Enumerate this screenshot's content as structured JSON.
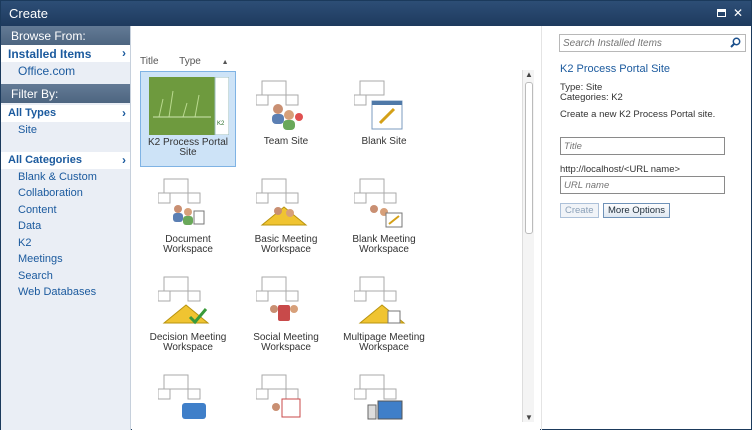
{
  "window": {
    "title": "Create"
  },
  "left": {
    "browse_header": "Browse From:",
    "installed_items": "Installed Items",
    "office": "Office.com",
    "filter_header": "Filter By:",
    "all_types": "All Types",
    "type_items": [
      "Site"
    ],
    "all_categories": "All Categories",
    "categories": [
      "Blank & Custom",
      "Collaboration",
      "Content",
      "Data",
      "K2",
      "Meetings",
      "Search",
      "Web Databases"
    ]
  },
  "middle": {
    "col_title": "Title",
    "col_type": "Type",
    "tiles": [
      {
        "label": "K2 Process Portal Site"
      },
      {
        "label": "Team Site"
      },
      {
        "label": "Blank Site"
      },
      {
        "label": "Document Workspace"
      },
      {
        "label": "Basic Meeting Workspace"
      },
      {
        "label": "Blank Meeting Workspace"
      },
      {
        "label": "Decision Meeting Workspace"
      },
      {
        "label": "Social Meeting Workspace"
      },
      {
        "label": "Multipage Meeting Workspace"
      },
      {
        "label": ""
      },
      {
        "label": ""
      },
      {
        "label": ""
      }
    ]
  },
  "right": {
    "search_placeholder": "Search Installed Items",
    "selected_title": "K2 Process Portal Site",
    "type_line": "Type: Site",
    "categories_line": "Categories: K2",
    "description": "Create a new K2 Process Portal site.",
    "title_placeholder": "Title",
    "url_prefix": "http://localhost/<URL name>",
    "url_placeholder": "URL name",
    "create_label": "Create",
    "more_options_label": "More Options"
  },
  "colors": {
    "title_bar": "#1e3a5e",
    "link": "#1b5a9e",
    "selected_tile": "#cde3f7"
  }
}
